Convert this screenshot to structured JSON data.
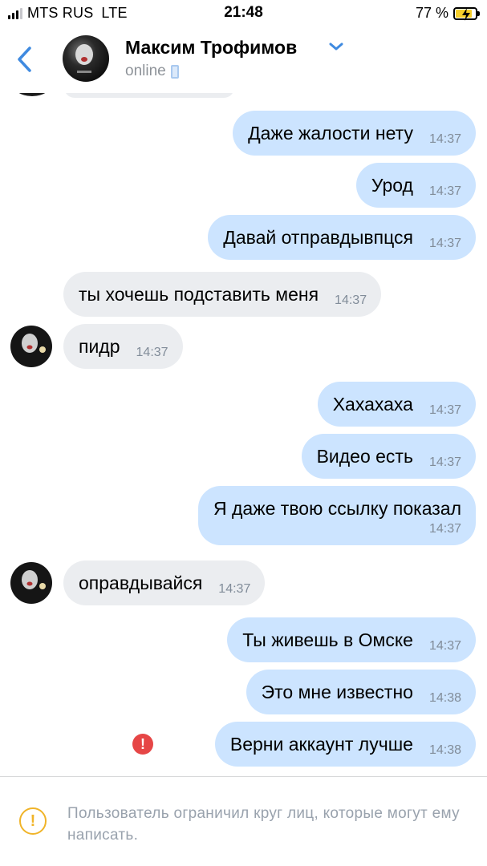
{
  "status_bar": {
    "carrier": "MTS RUS",
    "network": "LTE",
    "time": "21:48",
    "battery": "77 %",
    "battery_level": 0.77
  },
  "header": {
    "name": "Максим Трофимов",
    "status": "online"
  },
  "messages": [
    {
      "dir": "out",
      "text": "Даже жалости нету",
      "time": "14:37"
    },
    {
      "dir": "out",
      "text": "Урод",
      "time": "14:37"
    },
    {
      "dir": "out",
      "text": "Давай отправдывпцся",
      "time": "14:37"
    },
    {
      "dir": "in",
      "text": "ты хочешь подставить меня",
      "time": "14:37"
    },
    {
      "dir": "in",
      "text": "пидр",
      "time": "14:37"
    },
    {
      "dir": "out",
      "text": "Хахахаха",
      "time": "14:37"
    },
    {
      "dir": "out",
      "text": "Видео есть",
      "time": "14:37"
    },
    {
      "dir": "out",
      "text": "Я даже твою ссылку показал",
      "time": "14:37"
    },
    {
      "dir": "in",
      "text": "оправдывайся",
      "time": "14:37"
    },
    {
      "dir": "out",
      "text": "Ты живешь в Омске",
      "time": "14:37"
    },
    {
      "dir": "out",
      "text": "Это мне известно",
      "time": "14:38"
    },
    {
      "dir": "out",
      "text": "Верни аккаунт лучше",
      "time": "14:38",
      "error": true
    }
  ],
  "footer": {
    "notice": "Пользователь ограничил круг лиц, которые могут ему написать."
  },
  "colors": {
    "outgoing_bubble": "#cce4ff",
    "incoming_bubble": "#ebedf0",
    "accent": "#3f8ae0",
    "error": "#e64646",
    "warning": "#f0b429"
  }
}
